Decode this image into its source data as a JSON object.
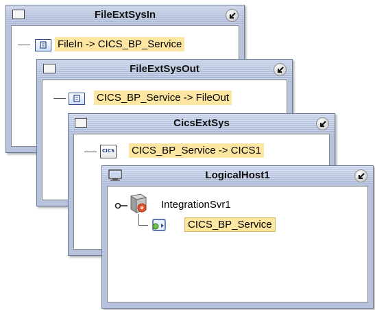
{
  "windows": {
    "file_in": {
      "title": "FileExtSysIn",
      "item_label": "FileIn -> CICS_BP_Service"
    },
    "file_out": {
      "title": "FileExtSysOut",
      "item_label": "CICS_BP_Service -> FileOut"
    },
    "cics": {
      "title": "CicsExtSys",
      "item_label": "CICS_BP_Service -> CICS1",
      "icon_text": "CICS"
    },
    "logical_host": {
      "title": "LogicalHost1",
      "server_label": "IntegrationSvr1",
      "service_label": "CICS_BP_Service"
    }
  },
  "icons": {
    "window_icon": "window-icon",
    "monitor_icon": "monitor-icon",
    "minimize_icon": "arrow-down-left-icon",
    "doc_icon": "connection-doc-icon",
    "cics_icon": "cics-icon",
    "server_icon": "integration-server-icon",
    "service_icon": "service-icon",
    "pin_icon": "pin-icon"
  },
  "colors": {
    "titlebar": "#b7c3dc",
    "highlight": "#fde6a1",
    "highlight_border": "#d7b55a"
  }
}
